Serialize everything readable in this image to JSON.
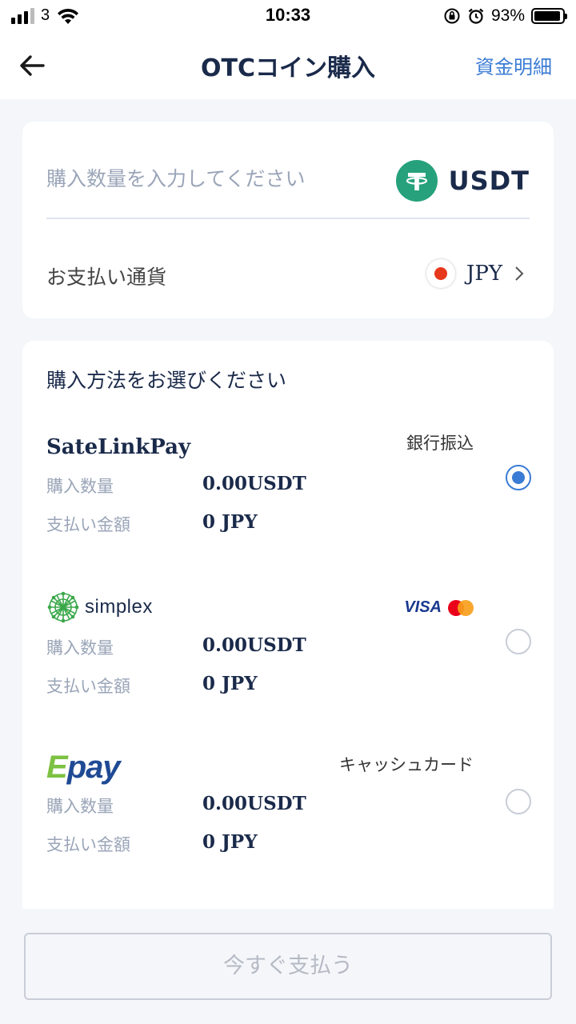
{
  "status_bar": {
    "carrier": "3",
    "time": "10:33",
    "battery_percent": "93%",
    "battery_level": 0.93,
    "signal_bars": 3
  },
  "header": {
    "title": "OTCコイン購入",
    "right_link": "資金明細",
    "back_icon": "back-arrow-icon"
  },
  "amount_card": {
    "input_value": "",
    "input_placeholder": "購入数量を入力してください",
    "coin": "USDT",
    "payment_currency_label": "お支払い通貨",
    "payment_currency": "JPY"
  },
  "methods_card": {
    "title": "購入方法をお選びください",
    "methods": [
      {
        "provider": "SateLinkPay",
        "tag": "銀行振込",
        "qty_label": "購入数量",
        "qty_value": "0.00USDT",
        "amount_label": "支払い金額",
        "amount_value": "0 JPY",
        "selected": true
      },
      {
        "provider": "simplex",
        "tag_icons": [
          "visa-logo",
          "mastercard-logo"
        ],
        "tag_text": "VISA",
        "qty_label": "購入数量",
        "qty_value": "0.00USDT",
        "amount_label": "支払い金額",
        "amount_value": "0 JPY",
        "selected": false
      },
      {
        "provider_e": "E",
        "provider_rest": "pay",
        "tag": "キャッシュカード",
        "qty_label": "購入数量",
        "qty_value": "0.00USDT",
        "amount_label": "支払い金額",
        "amount_value": "0 JPY",
        "selected": false
      }
    ]
  },
  "footer": {
    "pay_button": "今すぐ支払う"
  },
  "colors": {
    "accent": "#3a7bd5",
    "tether": "#26a17b",
    "background": "#f4f6fa",
    "epay_green": "#7dc142",
    "epay_blue": "#1f4a94"
  }
}
